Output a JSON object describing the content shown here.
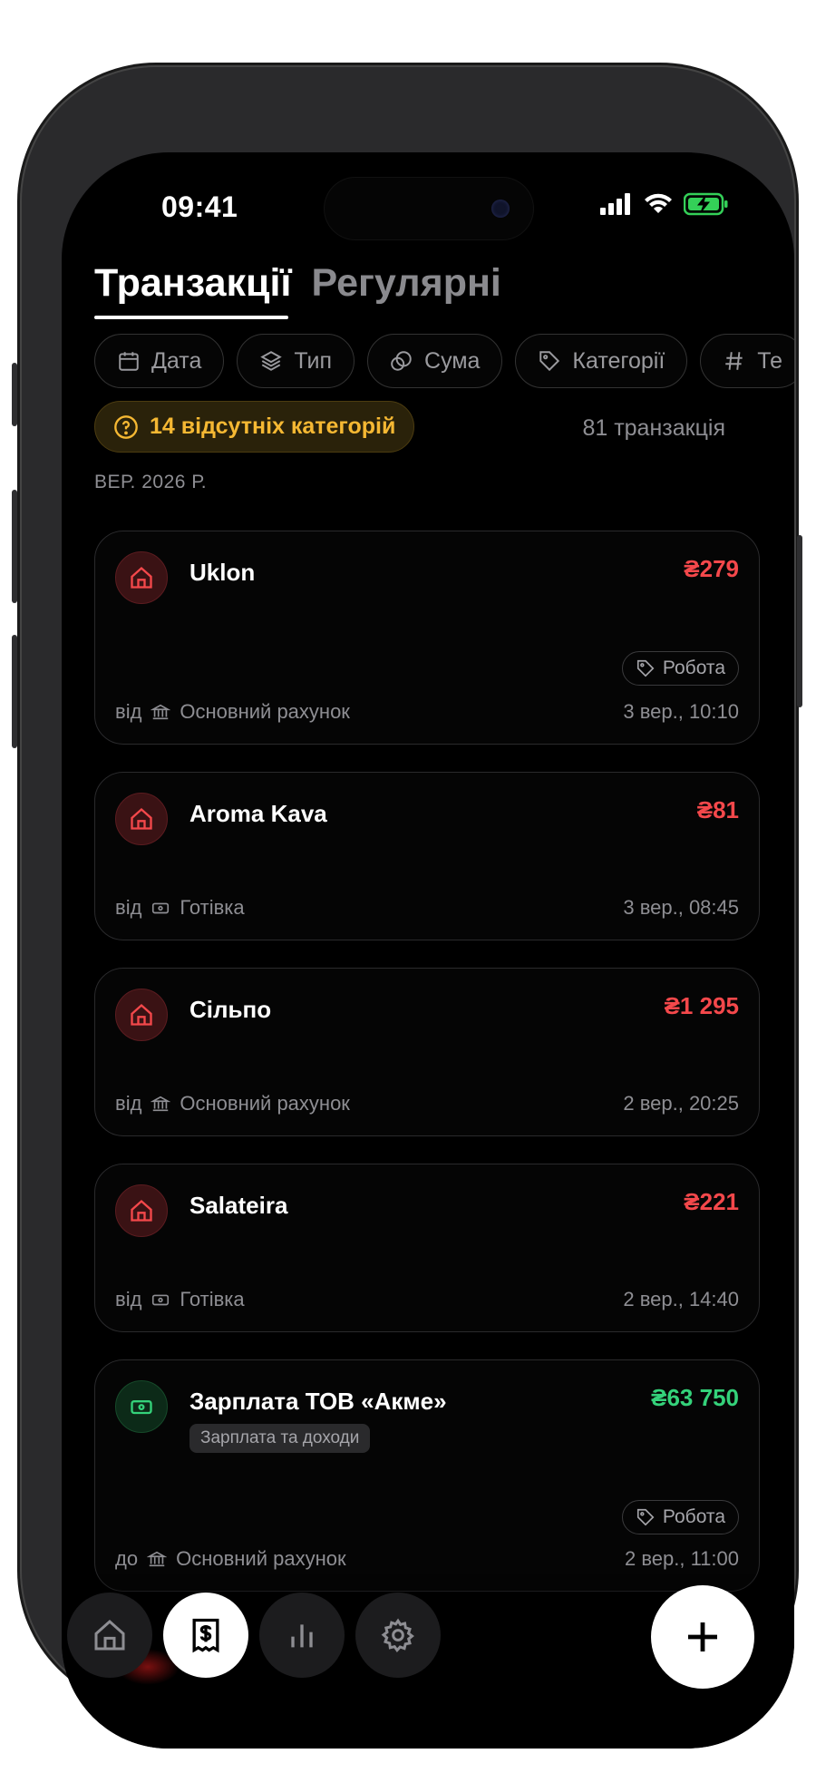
{
  "status_bar": {
    "time": "09:41"
  },
  "header": {
    "tabs": [
      {
        "label": "Транзакції",
        "active": true
      },
      {
        "label": "Регулярні",
        "active": false
      }
    ]
  },
  "filters": [
    {
      "label": "Дата",
      "icon": "calendar-icon"
    },
    {
      "label": "Тип",
      "icon": "layers-icon"
    },
    {
      "label": "Сума",
      "icon": "coins-icon"
    },
    {
      "label": "Категорії",
      "icon": "tag-icon"
    },
    {
      "label": "Те",
      "icon": "hash-icon"
    }
  ],
  "warning": {
    "label": "14 відсутніх категорій",
    "icon": "question-circle-icon"
  },
  "transactions_count": "81 транзакція",
  "month_label": "ВЕР. 2026 Р.",
  "transactions": [
    {
      "name": "Uklon",
      "amount": "₴279",
      "type": "expense",
      "icon": "home-icon",
      "tag": "Робота",
      "direction": "від",
      "account_icon": "bank-icon",
      "account": "Основний рахунок",
      "date": "3 вер., 10:10"
    },
    {
      "name": "Aroma Kava",
      "amount": "₴81",
      "type": "expense",
      "icon": "home-icon",
      "direction": "від",
      "account_icon": "cash-icon",
      "account": "Готівка",
      "date": "3 вер., 08:45"
    },
    {
      "name": "Сільпо",
      "amount": "₴1 295",
      "type": "expense",
      "icon": "home-icon",
      "direction": "від",
      "account_icon": "bank-icon",
      "account": "Основний рахунок",
      "date": "2 вер., 20:25"
    },
    {
      "name": "Salateira",
      "amount": "₴221",
      "type": "expense",
      "icon": "home-icon",
      "direction": "від",
      "account_icon": "cash-icon",
      "account": "Готівка",
      "date": "2 вер., 14:40"
    },
    {
      "name": "Зарплата ТОВ «Акме»",
      "amount": "₴63 750",
      "type": "income",
      "icon": "banknote-icon",
      "category": "Зарплата та доходи",
      "tag": "Робота",
      "direction": "до",
      "account_icon": "bank-icon",
      "account": "Основний рахунок",
      "date": "2 вер., 11:00"
    }
  ],
  "tab_bar": [
    {
      "name": "home",
      "icon": "home-icon",
      "active": false
    },
    {
      "name": "transactions",
      "icon": "receipt-icon",
      "active": true
    },
    {
      "name": "stats",
      "icon": "bar-chart-icon",
      "active": false
    },
    {
      "name": "settings",
      "icon": "gear-icon",
      "active": false
    }
  ],
  "fab": {
    "icon": "plus-icon"
  },
  "colors": {
    "expense": "#f4484b",
    "income": "#34d27a",
    "warning": "#f5b833",
    "background": "#000000"
  }
}
